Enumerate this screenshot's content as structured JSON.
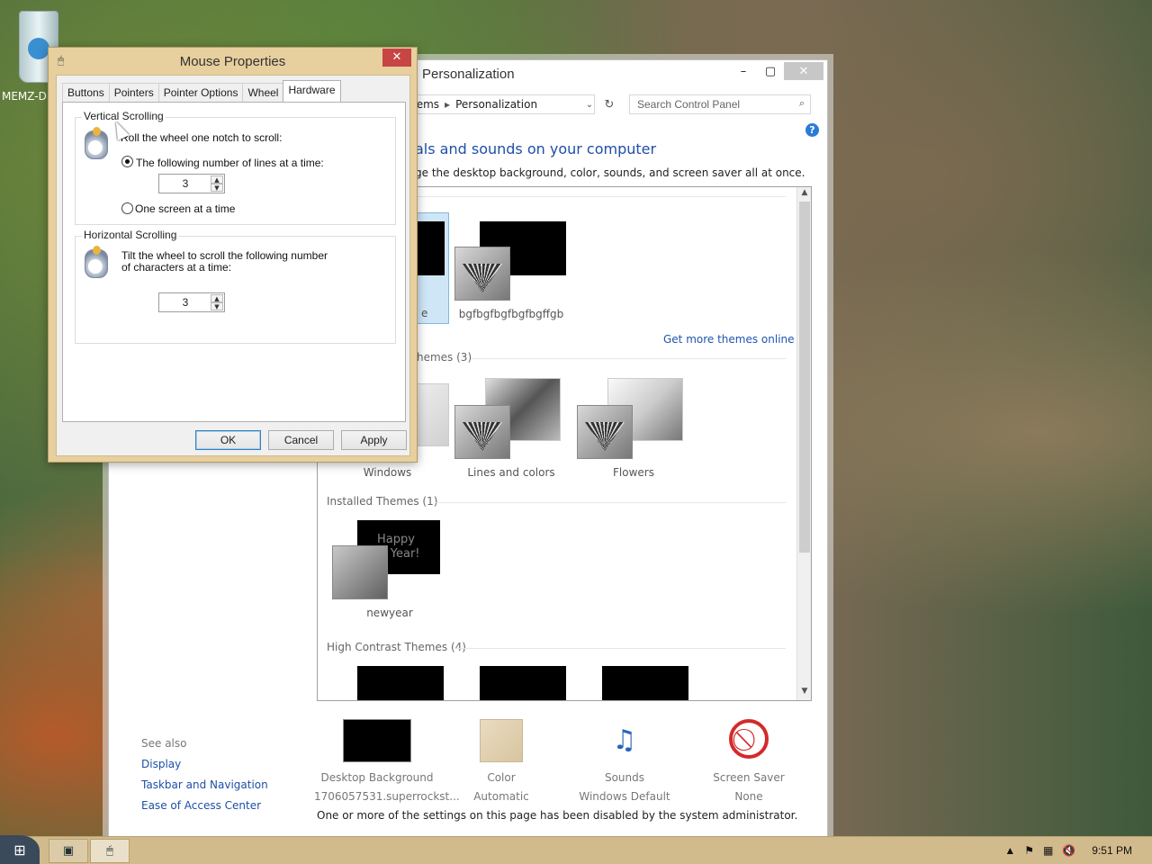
{
  "desktop": {
    "icon_label": "MEMZ-D"
  },
  "personalization": {
    "title": "Personalization",
    "address": {
      "crumb1": "tems",
      "crumb2": "Personalization"
    },
    "search_placeholder": "Search Control Panel",
    "heading": "als and sounds on your computer",
    "subheading": "ge the desktop background, color, sounds, and screen saver all at once.",
    "my_themes": [
      {
        "label": "e"
      },
      {
        "label": "bgfbgfbgfbgfbgffgb"
      }
    ],
    "get_more_link": "Get more themes online",
    "default_section": "hemes (3)",
    "default_themes": [
      {
        "label": "Windows"
      },
      {
        "label": "Lines and colors"
      },
      {
        "label": "Flowers"
      }
    ],
    "installed_section": "Installed Themes (1)",
    "installed_themes": [
      {
        "label": "newyear",
        "overlay": "Happy\nw Year!"
      }
    ],
    "high_contrast_section": "High Contrast Themes (4)",
    "bottom_items": [
      {
        "label": "Desktop Background",
        "sublabel": "1706057531.superrockst..."
      },
      {
        "label": "Color",
        "sublabel": "Automatic"
      },
      {
        "label": "Sounds",
        "sublabel": "Windows Default"
      },
      {
        "label": "Screen Saver",
        "sublabel": "None"
      }
    ],
    "see_also": "See also",
    "side_links": [
      "Display",
      "Taskbar and Navigation",
      "Ease of Access Center"
    ],
    "disabled_message": "One or more of the settings on this page has been disabled by the system administrator."
  },
  "mouse": {
    "title": "Mouse Properties",
    "tabs": [
      "Buttons",
      "Pointers",
      "Pointer Options",
      "Wheel",
      "Hardware"
    ],
    "active_tab": "Hardware",
    "vertical": {
      "title": "Vertical Scrolling",
      "desc": "Roll the wheel one notch to scroll:",
      "option_lines": "The following number of lines at a time:",
      "lines_value": "3",
      "option_screen": "One screen at a time"
    },
    "horizontal": {
      "title": "Horizontal Scrolling",
      "desc_line1": "Tilt the wheel to scroll the following number",
      "desc_line2": "of characters at a time:",
      "chars_value": "3"
    },
    "buttons": {
      "ok": "OK",
      "cancel": "Cancel",
      "apply": "Apply"
    }
  },
  "taskbar": {
    "time": "9:51 PM"
  }
}
